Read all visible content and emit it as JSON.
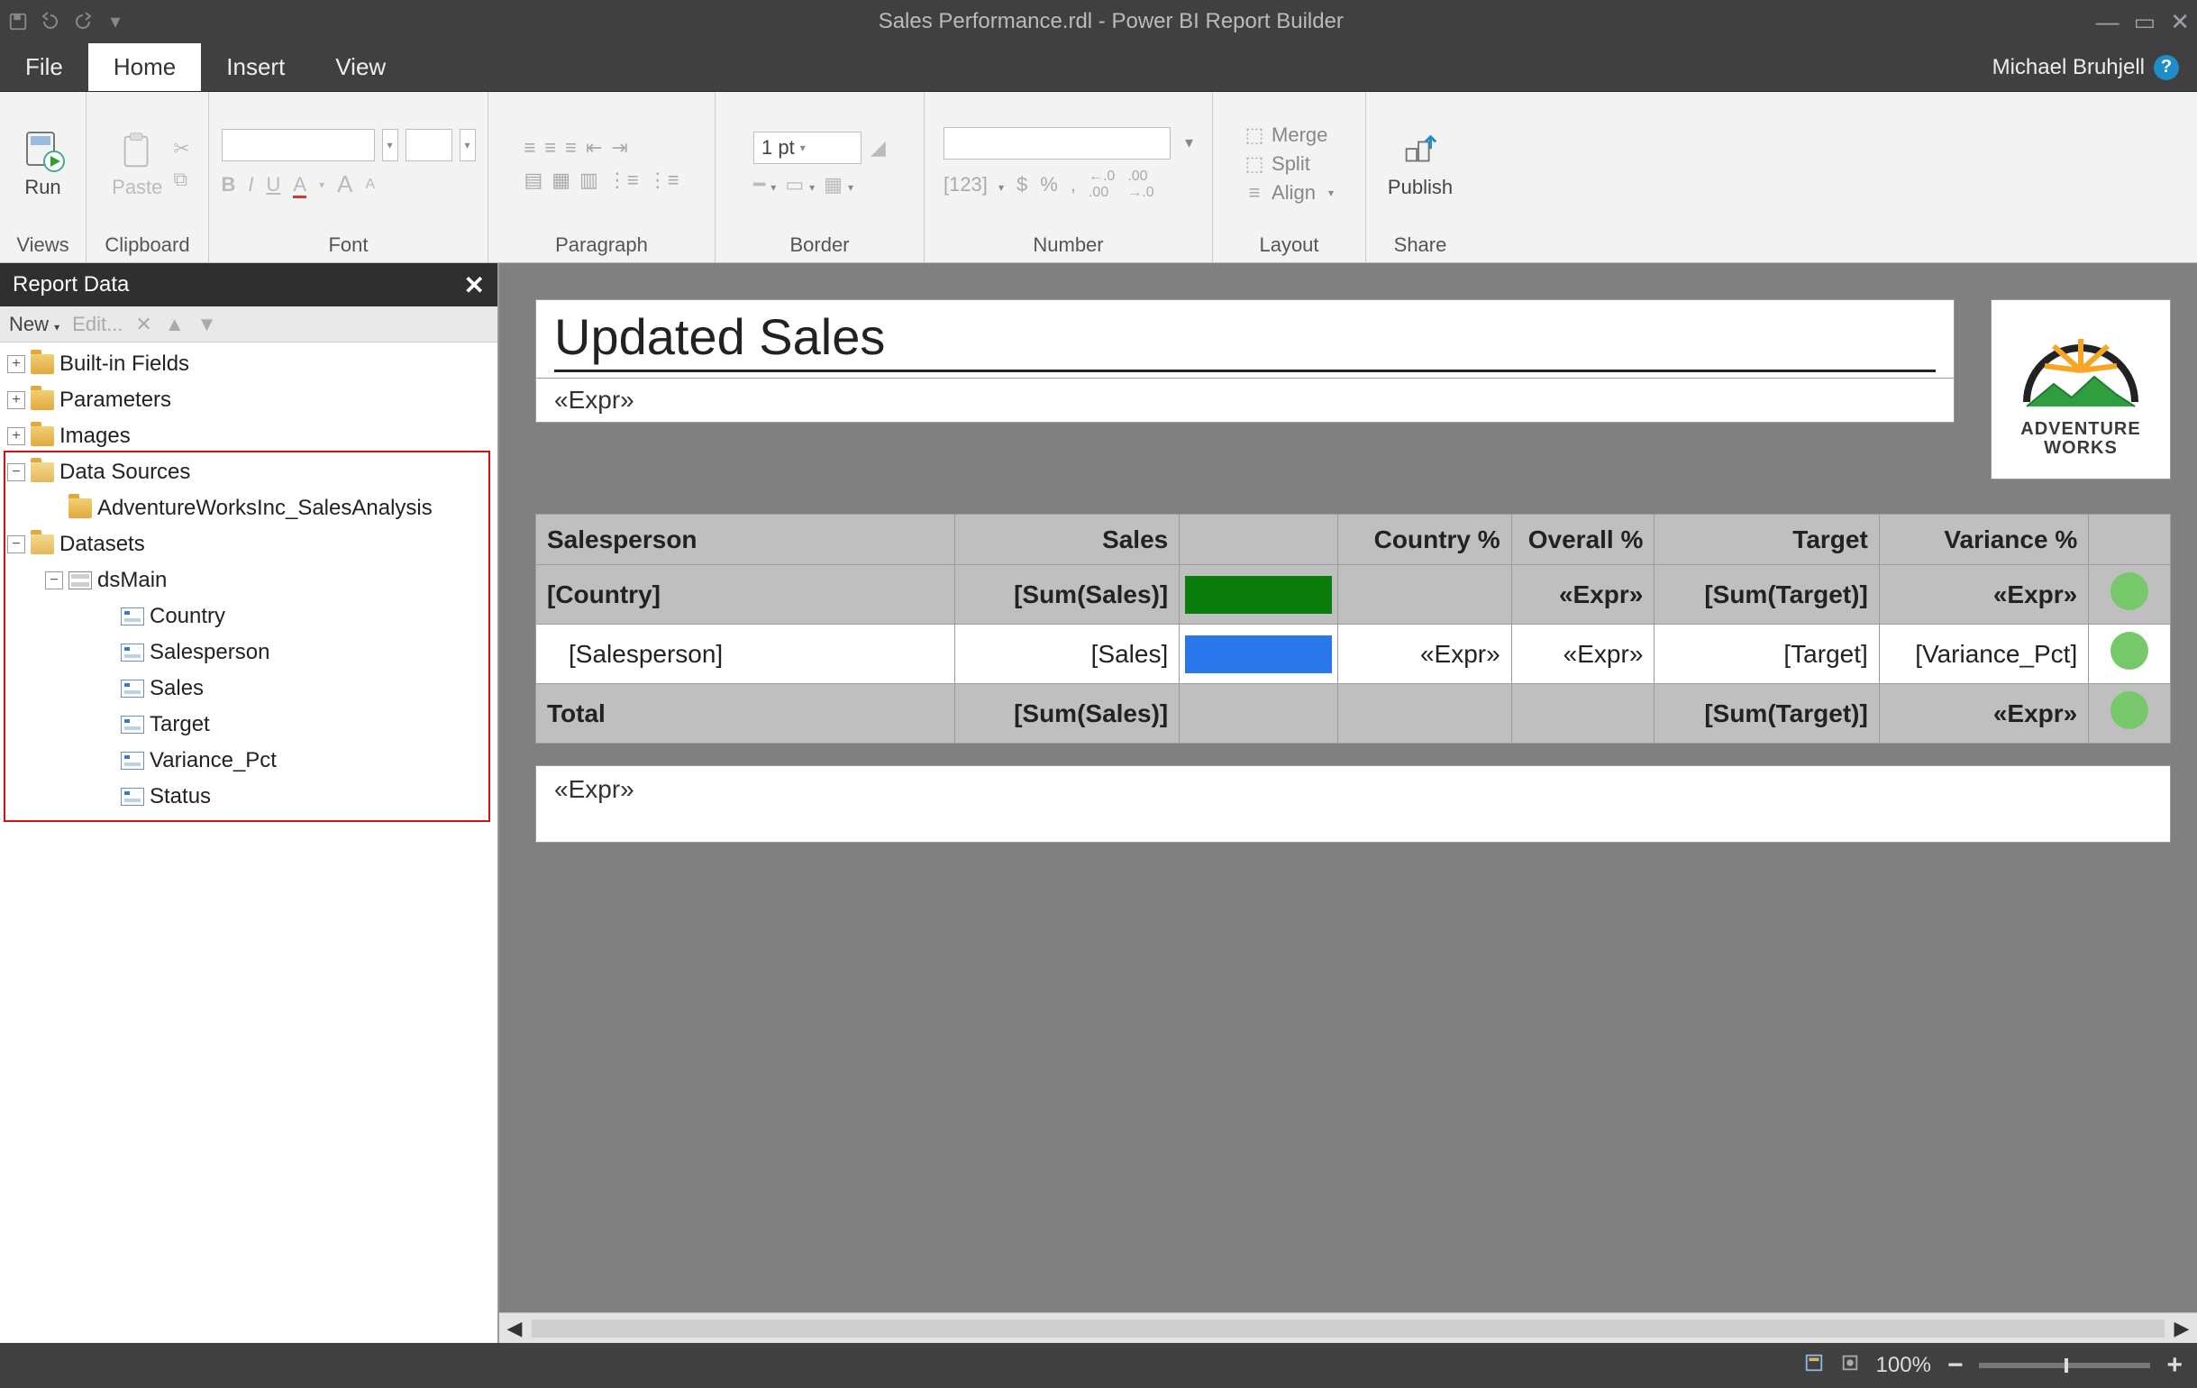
{
  "titlebar": {
    "title": "Sales Performance.rdl - Power BI Report Builder"
  },
  "menu": {
    "file": "File",
    "home": "Home",
    "insert": "Insert",
    "view": "View",
    "user": "Michael Bruhjell"
  },
  "ribbon": {
    "views": {
      "run": "Run",
      "label": "Views"
    },
    "clipboard": {
      "paste": "Paste",
      "label": "Clipboard"
    },
    "font": {
      "label": "Font",
      "bold": "B",
      "italic": "I",
      "underline": "U"
    },
    "paragraph": {
      "label": "Paragraph"
    },
    "border": {
      "label": "Border",
      "pt": "1 pt"
    },
    "number": {
      "label": "Number"
    },
    "layout": {
      "label": "Layout",
      "merge": "Merge",
      "split": "Split",
      "align": "Align"
    },
    "share": {
      "label": "Share",
      "publish": "Publish"
    }
  },
  "panel": {
    "title": "Report Data",
    "new": "New",
    "edit": "Edit...",
    "tree": {
      "builtin": "Built-in Fields",
      "parameters": "Parameters",
      "images": "Images",
      "datasources": "Data Sources",
      "datasource1": "AdventureWorksInc_SalesAnalysis",
      "datasets": "Datasets",
      "dataset1": "dsMain",
      "fields": {
        "country": "Country",
        "salesperson": "Salesperson",
        "sales": "Sales",
        "target": "Target",
        "variance_pct": "Variance_Pct",
        "status": "Status"
      }
    }
  },
  "report": {
    "title": "Updated Sales",
    "subexpr": "«Expr»",
    "logo_top": "ADVENTURE",
    "logo_bottom": "WORKS",
    "headers": {
      "salesperson": "Salesperson",
      "sales": "Sales",
      "countryp": "Country %",
      "overallp": "Overall %",
      "target": "Target",
      "variancep": "Variance %"
    },
    "rows": {
      "country_group": {
        "salesperson": "[Country]",
        "sales": "[Sum(Sales)]",
        "overallp": "«Expr»",
        "target": "[Sum(Target)]",
        "variancep": "«Expr»"
      },
      "detail": {
        "salesperson": "[Salesperson]",
        "sales": "[Sales]",
        "countryp": "«Expr»",
        "overallp": "«Expr»",
        "target": "[Target]",
        "variancep": "[Variance_Pct]"
      },
      "total": {
        "label": "Total",
        "sales": "[Sum(Sales)]",
        "target": "[Sum(Target)]",
        "variancep": "«Expr»"
      }
    },
    "footer_expr": "«Expr»"
  },
  "status": {
    "zoom": "100%"
  }
}
